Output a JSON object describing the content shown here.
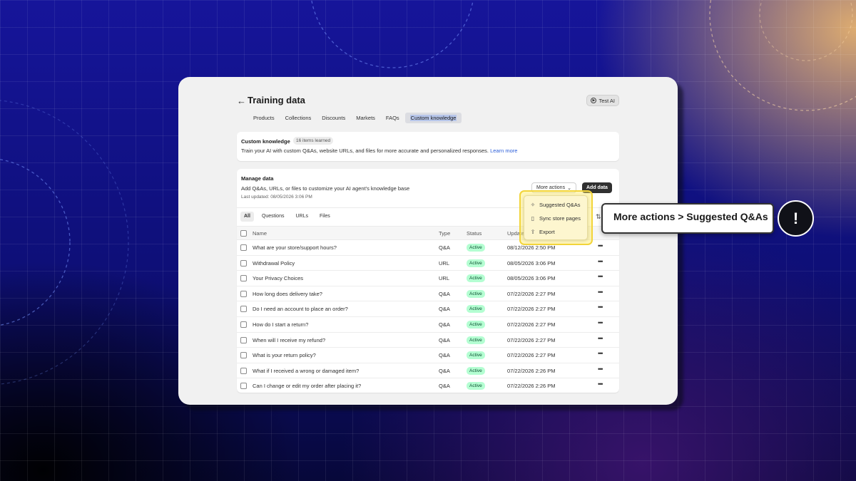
{
  "header": {
    "title": "Training data",
    "test_ai_label": "Test AI"
  },
  "tabs": [
    "Products",
    "Collections",
    "Discounts",
    "Markets",
    "FAQs",
    "Custom knowledge"
  ],
  "custom_knowledge": {
    "title": "Custom knowledge",
    "badge": "16 items learned",
    "description": "Train your AI with custom Q&As, website URLs, and files for more accurate and personalized responses.",
    "link": "Learn more"
  },
  "manage_data": {
    "title": "Manage data",
    "description": "Add Q&As, URLs, or files to customize your AI agent's knowledge base",
    "last_updated": "Last updated: 08/05/2026 3:06 PM",
    "more_actions_label": "More actions",
    "add_data_label": "Add data"
  },
  "filters": [
    "All",
    "Questions",
    "URLs",
    "Files"
  ],
  "table": {
    "headers": {
      "name": "Name",
      "type": "Type",
      "status": "Status",
      "updated": "Update"
    },
    "rows": [
      {
        "name": "What are your store/support hours?",
        "type": "Q&A",
        "status": "Active",
        "updated": "08/12/2026 2:50 PM"
      },
      {
        "name": "Withdrawal Policy",
        "type": "URL",
        "status": "Active",
        "updated": "08/05/2026 3:06 PM"
      },
      {
        "name": "Your Privacy Choices",
        "type": "URL",
        "status": "Active",
        "updated": "08/05/2026 3:06 PM"
      },
      {
        "name": "How long does delivery take?",
        "type": "Q&A",
        "status": "Active",
        "updated": "07/22/2026 2:27 PM"
      },
      {
        "name": "Do I need an account to place an order?",
        "type": "Q&A",
        "status": "Active",
        "updated": "07/22/2026 2:27 PM"
      },
      {
        "name": "How do I start a return?",
        "type": "Q&A",
        "status": "Active",
        "updated": "07/22/2026 2:27 PM"
      },
      {
        "name": "When will I receive my refund?",
        "type": "Q&A",
        "status": "Active",
        "updated": "07/22/2026 2:27 PM"
      },
      {
        "name": "What is your return policy?",
        "type": "Q&A",
        "status": "Active",
        "updated": "07/22/2026 2:27 PM"
      },
      {
        "name": "What if I received a wrong or damaged item?",
        "type": "Q&A",
        "status": "Active",
        "updated": "07/22/2026 2:26 PM"
      },
      {
        "name": "Can I change or edit my order after placing it?",
        "type": "Q&A",
        "status": "Active",
        "updated": "07/22/2026 2:26 PM"
      }
    ]
  },
  "dropdown": {
    "items": [
      {
        "label": "Suggested Q&As",
        "icon": "sparkle-icon"
      },
      {
        "label": "Sync store pages",
        "icon": "page-icon"
      },
      {
        "label": "Export",
        "icon": "export-icon"
      }
    ]
  },
  "callout": {
    "text": "More actions > Suggested Q&As",
    "alert": "!"
  },
  "colors": {
    "accent_link": "#2c5fd9",
    "active_badge": "#b4fed2",
    "highlight": "#f2d43a"
  }
}
